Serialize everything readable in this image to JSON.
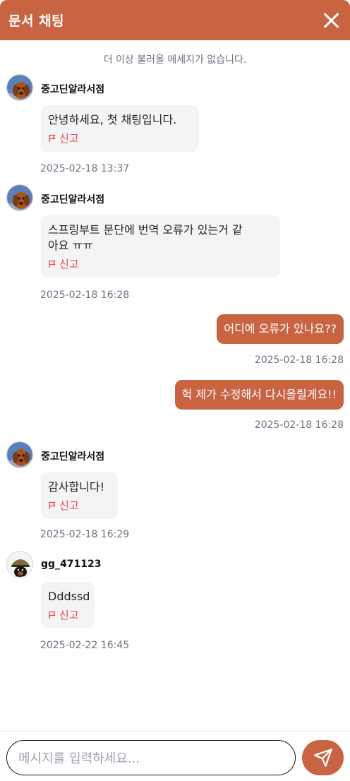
{
  "header": {
    "title": "문서 채팅"
  },
  "notice": "더 이상 불러올 메세지가 없습니다.",
  "messages": [
    {
      "sender": "중고딘알라서점",
      "text": "안녕하세요, 첫 채팅입니다.",
      "report": "신고",
      "time": "2025-02-18 13:37"
    },
    {
      "sender": "중고딘알라서점",
      "text_line1": "스프링부트 문단에 번역 오류가 있는거 같",
      "text_line2": "아요 ㅠㅠ",
      "report": "신고",
      "time": "2025-02-18 16:28"
    },
    {
      "text": "어디에 오류가 있나요??",
      "time": "2025-02-18 16:28"
    },
    {
      "text": "헉 제가 수정해서 다시올릴게요!!",
      "time": "2025-02-18 16:28"
    },
    {
      "sender": "중고딘알라서점",
      "text": "감사합니다!",
      "report": "신고",
      "time": "2025-02-18 16:29"
    },
    {
      "sender": "gg_471123",
      "text": "Dddssd",
      "report": "신고",
      "time": "2025-02-22 16:45"
    }
  ],
  "composer": {
    "placeholder": "메시지를 입력하세요..."
  },
  "colors": {
    "accent": "#c96443",
    "report": "#e5484d",
    "bubble_in": "#f3f4f6"
  },
  "icons": {
    "close": "close-icon",
    "flag": "flag-icon",
    "send": "send-icon"
  }
}
